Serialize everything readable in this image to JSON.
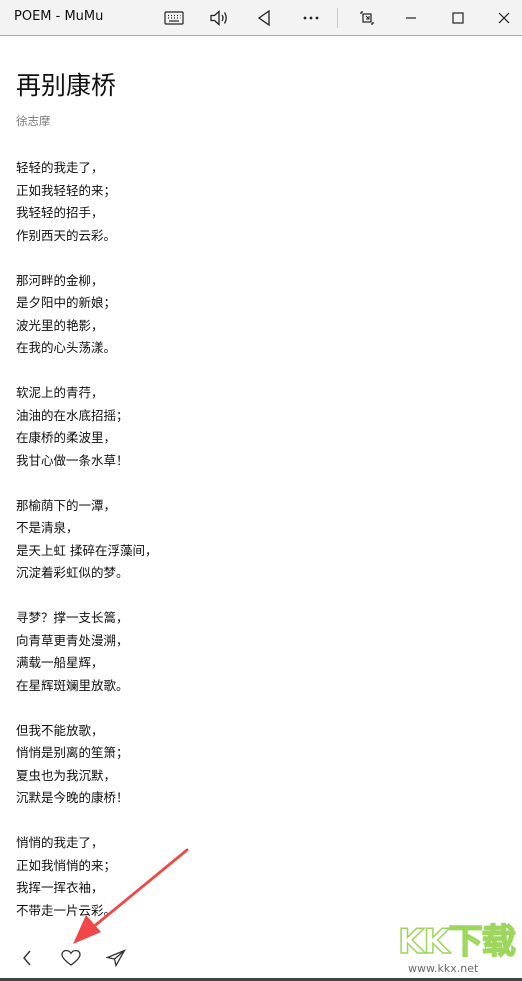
{
  "window": {
    "title": "POEM - MuMu"
  },
  "poem": {
    "title": "再别康桥",
    "author": "徐志摩",
    "stanzas": [
      [
        "轻轻的我走了，",
        "正如我轻轻的来；",
        "我轻轻的招手，",
        "作别西天的云彩。"
      ],
      [
        "那河畔的金柳，",
        "是夕阳中的新娘；",
        "波光里的艳影，",
        "在我的心头荡漾。"
      ],
      [
        "软泥上的青荇，",
        "油油的在水底招摇；",
        "在康桥的柔波里，",
        "我甘心做一条水草！"
      ],
      [
        "那榆荫下的一潭，",
        "不是清泉，",
        "是天上虹 揉碎在浮藻间，",
        "沉淀着彩虹似的梦。"
      ],
      [
        "寻梦？撑一支长篙，",
        "向青草更青处漫溯，",
        "满载一船星辉，",
        "在星辉斑斓里放歌。"
      ],
      [
        "但我不能放歌，",
        "悄悄是别离的笙箫；",
        "夏虫也为我沉默，",
        "沉默是今晚的康桥！"
      ],
      [
        "悄悄的我走了，",
        "正如我悄悄的来；",
        "我挥一挥衣袖，",
        "不带走一片云彩。"
      ]
    ]
  },
  "watermark": {
    "brand": "KK下载",
    "url": "www.kkx.net"
  },
  "icons": {
    "keyboard": "keyboard-icon",
    "volume": "volume-icon",
    "back": "back-triangle-icon",
    "more": "more-icon",
    "screenshot": "screenshot-icon",
    "minimize": "minimize-icon",
    "maximize": "maximize-icon",
    "close": "close-icon",
    "chevron": "chevron-left-icon",
    "heart": "heart-icon",
    "share": "send-icon"
  },
  "colors": {
    "arrow": "#f04848",
    "watermark_green": "#9dd65c"
  }
}
